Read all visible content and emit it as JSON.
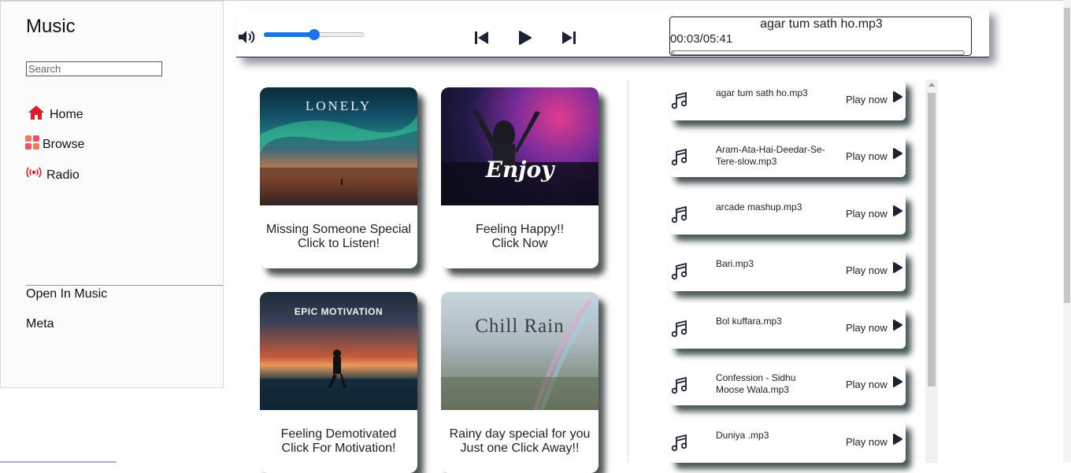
{
  "sidebar": {
    "brand": "Music",
    "search_placeholder": "Search",
    "nav": [
      {
        "label": "Home",
        "icon": "home-icon",
        "color": "#e0192b"
      },
      {
        "label": "Browse",
        "icon": "grid-icon",
        "color": "#f05a5a"
      },
      {
        "label": "Radio",
        "icon": "radio-icon",
        "color": "#e0192b"
      }
    ],
    "links": [
      "Open In Music",
      "Meta"
    ]
  },
  "player": {
    "track": "agar tum sath ho.mp3",
    "time": "00:03/05:41",
    "volume": 0.5,
    "progress": 0.009,
    "accent": "#1a73e8"
  },
  "cards": [
    {
      "art_title": "LONELY",
      "caption_line1": "Missing Someone Special",
      "caption_line2": "Click to Listen!"
    },
    {
      "art_title": "Enjoy",
      "caption_line1": "Feeling Happy!!",
      "caption_line2": "Click Now"
    },
    {
      "art_title": "EPIC MOTIVATION",
      "caption_line1": "Feeling Demotivated",
      "caption_line2": "Click For Motivation!"
    },
    {
      "art_title": "Chill Rain",
      "caption_line1": "Rainy day special for you",
      "caption_line2": "Just one Click Away!!"
    }
  ],
  "songs": [
    {
      "name": "agar tum sath ho.mp3",
      "action": "Play now"
    },
    {
      "name": "Aram-Ata-Hai-Deedar-Se-Tere-slow.mp3",
      "action": "Play now"
    },
    {
      "name": "arcade mashup.mp3",
      "action": "Play now"
    },
    {
      "name": "Bari.mp3",
      "action": "Play now"
    },
    {
      "name": "Bol kuffara.mp3",
      "action": "Play now"
    },
    {
      "name": "Confession - Sidhu Moose Wala.mp3",
      "action": "Play now"
    },
    {
      "name": "Duniya .mp3",
      "action": "Play now"
    }
  ]
}
